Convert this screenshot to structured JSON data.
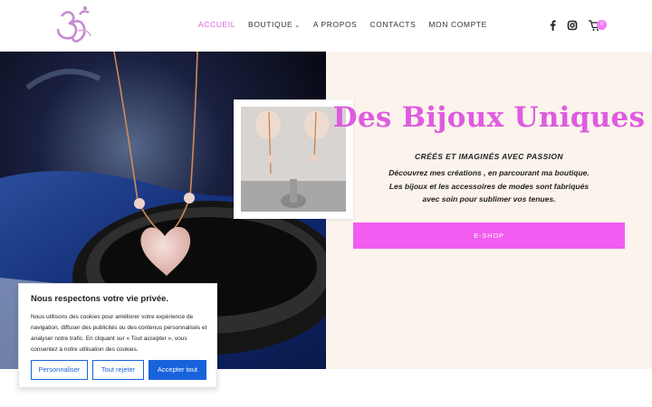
{
  "header": {
    "logo_icon": "om-symbol-logo",
    "nav": [
      {
        "label": "ACCUEIL",
        "active": true
      },
      {
        "label": "BOUTIQUE",
        "dropdown": true
      },
      {
        "label": "A PROPOS"
      },
      {
        "label": "CONTACTS"
      },
      {
        "label": "MON COMPTE"
      }
    ],
    "social_icons": [
      "facebook-icon",
      "instagram-icon"
    ],
    "cart": {
      "icon": "cart-icon",
      "count": "0"
    }
  },
  "hero": {
    "title": "Des Bijoux Uniques",
    "subtitle": "CRÉÉS ET IMAGINÉS AVEC PASSION",
    "desc_lines": [
      "Découvrez mes créations , en parcourant ma boutique.",
      "Les bijoux et les accessoires de modes sont fabriqués",
      "avec soin pour sublimer vos tenues."
    ],
    "cta_label": "E-SHOP"
  },
  "cookie": {
    "title": "Nous respectons votre vie privée.",
    "text": "Nous utilisons des cookies pour améliorer votre expérience de navigation, diffuser des publicités ou des contenus personnalisés et analyser notre trafic. En cliquant sur « Tout accepter », vous consentez à notre utilisation des cookies.",
    "buttons": {
      "customize": "Personnaliser",
      "reject": "Tout rejeter",
      "accept": "Accepter tout"
    }
  },
  "colors": {
    "accent": "#de5ce0",
    "cta": "#f25cf0",
    "cookie_blue": "#1863dc",
    "hero_bg": "#fbf3ec"
  }
}
